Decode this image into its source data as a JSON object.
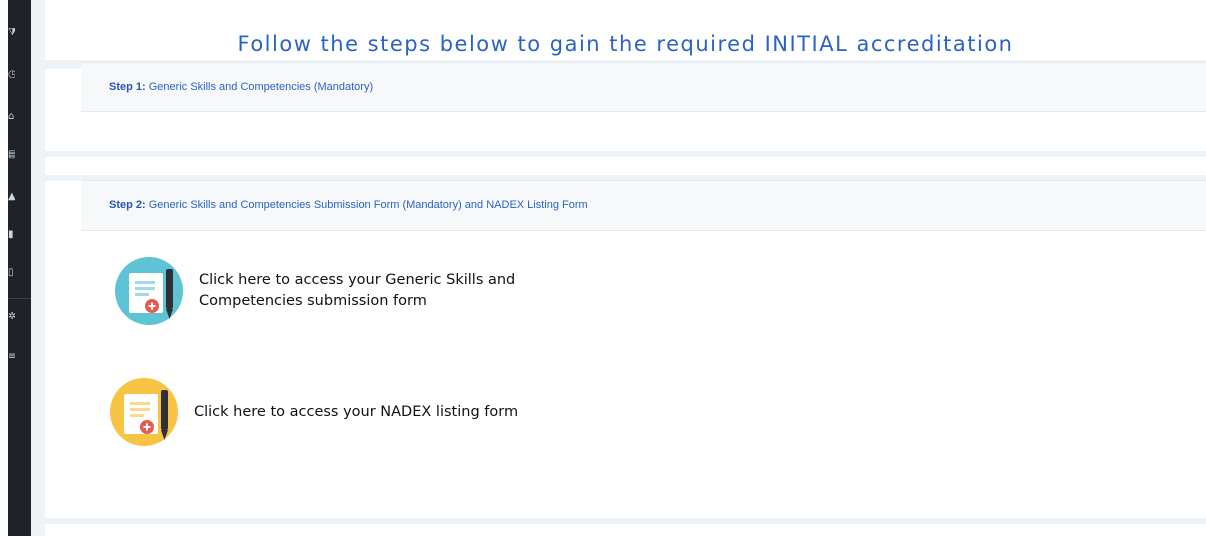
{
  "sidebar": {
    "icons": [
      "filter-icon",
      "clock-icon",
      "home-icon",
      "calendar-icon",
      "graduation-icon",
      "briefcase-icon",
      "folder-icon",
      "gear-icon",
      "menu-icon"
    ]
  },
  "main": {
    "title": "Follow the steps below to gain the required INITIAL accreditation",
    "steps": [
      {
        "label": "Step 1:",
        "text": " Generic Skills and Competencies (Mandatory)"
      },
      {
        "label": "Step 2:",
        "text": " Generic Skills and Competencies Submission Form (Mandatory) and NADEX Listing Form",
        "links": [
          {
            "text": "Click here to access your Generic Skills and Competencies submission form",
            "icon": "form-document-icon",
            "icon_color": "#5fc3d6"
          },
          {
            "text": "Click here to access your NADEX listing form",
            "icon": "form-document-icon",
            "icon_color": "#f6c343"
          }
        ]
      }
    ]
  },
  "colors": {
    "accent": "#2b63c4",
    "sidebar_bg": "#1f2329",
    "band_bg": "#edf2f7"
  }
}
